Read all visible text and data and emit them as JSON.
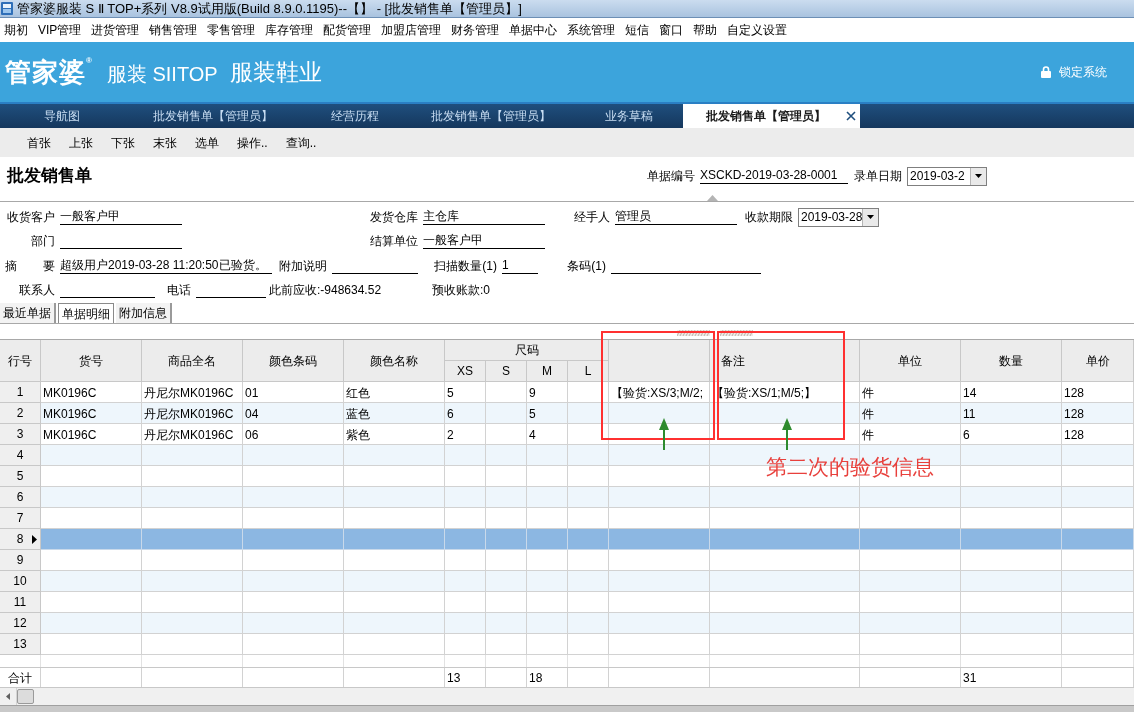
{
  "window": {
    "title": "管家婆服装 S Ⅱ TOP+系列 V8.9试用版(Build 8.9.0.1195)--【】 - [批发销售单【管理员】]"
  },
  "menu": [
    "期初",
    "VIP管理",
    "进货管理",
    "销售管理",
    "零售管理",
    "库存管理",
    "配货管理",
    "加盟店管理",
    "财务管理",
    "单据中心",
    "系统管理",
    "短信",
    "窗口",
    "帮助",
    "自定义设置"
  ],
  "banner": {
    "logo": "管家婆$^{®}$",
    "product": "服装 SIITOP",
    "industry": "服装鞋业",
    "lock_button": "锁定系统"
  },
  "tabs": [
    {
      "label": "导航图",
      "selected": false,
      "closable": false
    },
    {
      "label": "批发销售单【管理员】",
      "selected": false,
      "closable": false
    },
    {
      "label": "经营历程",
      "selected": false,
      "closable": false
    },
    {
      "label": "批发销售单【管理员】",
      "selected": false,
      "closable": false
    },
    {
      "label": "业务草稿",
      "selected": false,
      "closable": false
    },
    {
      "label": "批发销售单【管理员】",
      "selected": true,
      "closable": true
    }
  ],
  "toolbar": [
    "首张",
    "上张",
    "下张",
    "末张",
    "选单",
    "操作..",
    "查询.."
  ],
  "document": {
    "title": "批发销售单",
    "fields": [
      {
        "kind": "text",
        "label": "单据编号",
        "value": "XSCKD-2019-03-28-0001"
      },
      {
        "kind": "dropdown",
        "label": "录单日期",
        "value": "2019-03-2"
      }
    ]
  },
  "form_rows": [
    [
      {
        "kind": "text",
        "label": "收货客户",
        "value": "一般客户甲"
      },
      {
        "kind": "text",
        "label": "发货仓库",
        "value": "主仓库"
      },
      {
        "kind": "text",
        "label": "经手人",
        "value": "管理员"
      },
      {
        "kind": "dropdown",
        "label": "收款期限",
        "value": "2019-03-28"
      }
    ],
    [
      {
        "kind": "text",
        "label": "部门"
      },
      {
        "kind": "text",
        "label": "结算单位",
        "value": "一般客户甲"
      }
    ],
    [
      {
        "kind": "text",
        "label": "摘 要",
        "value": "超级用户2019-03-28 11:20:50已验货。"
      },
      {
        "kind": "text",
        "label": "附加说明"
      },
      {
        "kind": "text",
        "label": "扫描数量(1)",
        "value": "1"
      },
      {
        "kind": "text",
        "label": "条码(1)"
      }
    ],
    [
      {
        "kind": "text",
        "label": "联系人"
      },
      {
        "kind": "text",
        "label": "电话"
      },
      {
        "kind": "info",
        "text": "此前应收:-948634.52"
      },
      {
        "kind": "info",
        "text": "预收账款:0"
      }
    ]
  ],
  "detail_tabs": [
    {
      "label": "最近单据",
      "selected": false
    },
    {
      "label": "单据明细",
      "selected": true
    },
    {
      "label": "附加信息",
      "selected": false
    }
  ],
  "table": {
    "column_groups": [
      {
        "label": "尺码"
      }
    ],
    "columns": [
      {
        "label": "行号",
        "highlighted": false
      },
      {
        "label": "货号",
        "highlighted": false
      },
      {
        "label": "商品全名",
        "highlighted": false
      },
      {
        "label": "颜色条码",
        "highlighted": false
      },
      {
        "label": "颜色名称",
        "highlighted": false
      },
      {
        "label": "XS",
        "highlighted": false
      },
      {
        "label": "S",
        "highlighted": false
      },
      {
        "label": "M",
        "highlighted": false
      },
      {
        "label": "L",
        "highlighted": false
      },
      {
        "highlighted": true
      },
      {
        "label": "备注",
        "highlighted": true
      },
      {
        "label": "单位",
        "highlighted": false
      },
      {
        "label": "数量",
        "highlighted": false
      },
      {
        "label": "单价",
        "highlighted": false
      }
    ],
    "rows": [
      {
        "selected": false,
        "cells": [
          "1",
          "MK0196C",
          "丹尼尔MK0196C",
          "01",
          "红色",
          "5",
          "",
          "9",
          "",
          "【验货:XS/3;M/2;",
          "【验货:XS/1;M/5;】",
          "件",
          "14",
          "128"
        ]
      },
      {
        "selected": false,
        "cells": [
          "2",
          "MK0196C",
          "丹尼尔MK0196C",
          "04",
          "蓝色",
          "6",
          "",
          "5",
          "",
          "",
          "",
          "件",
          "11",
          "128"
        ]
      },
      {
        "selected": false,
        "cells": [
          "3",
          "MK0196C",
          "丹尼尔MK0196C",
          "06",
          "紫色",
          "2",
          "",
          "4",
          "",
          "",
          "",
          "件",
          "6",
          "128"
        ]
      },
      {
        "selected": false,
        "cells": [
          "4"
        ]
      },
      {
        "selected": false,
        "cells": [
          "5"
        ]
      },
      {
        "selected": false,
        "cells": [
          "6"
        ]
      },
      {
        "selected": false,
        "cells": [
          "7"
        ]
      },
      {
        "selected": true,
        "cells": [
          "8"
        ]
      },
      {
        "selected": false,
        "cells": [
          "9"
        ]
      },
      {
        "selected": false,
        "cells": [
          "10"
        ]
      },
      {
        "selected": false,
        "cells": [
          "11"
        ]
      },
      {
        "selected": false,
        "cells": [
          "12"
        ]
      },
      {
        "selected": false,
        "cells": [
          "13"
        ]
      }
    ],
    "totals": {
      "label": "合计",
      "xs": "13",
      "m": "18",
      "quantity": "31"
    }
  },
  "annotation": {
    "note": "第二次的验货信息"
  }
}
